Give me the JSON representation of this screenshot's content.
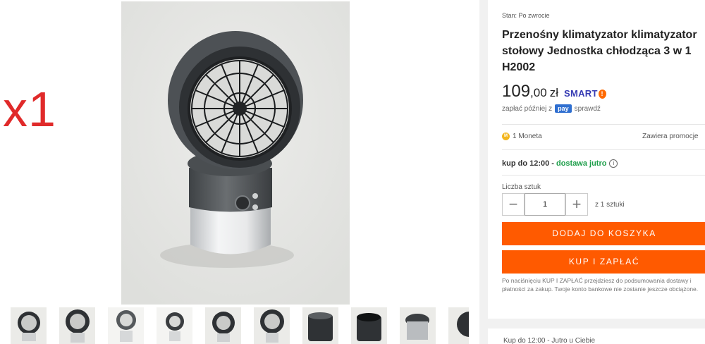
{
  "overlay": {
    "label": "x1",
    "color": "#e02a2a"
  },
  "gallery": {
    "thumbnail_count": 10
  },
  "product": {
    "condition": "Stan: Po zwrocie",
    "title_lines": [
      "Przenośny klimatyzator klimatyzator",
      "stołowy Jednostka chłodząca 3 w 1",
      "H2002"
    ],
    "price_int": "109",
    "price_dec": ",00",
    "currency": "zł",
    "smart_label": "SMART",
    "pay_later_text": "zapłać później z",
    "pay_brand": "pay",
    "pay_check": "sprawdź",
    "coin_label": "1 Moneta",
    "promo_label": "Zawiera promocje",
    "delivery_prefix": "kup do 12:00 -",
    "delivery_highlight": "dostawa jutro",
    "qty_label": "Liczba sztuk",
    "qty_value": "1",
    "qty_of": "z 1 sztuki",
    "add_to_cart": "DODAJ DO KOSZYKA",
    "buy_now": "KUP I ZAPŁAĆ",
    "disclaimer": "Po naciśnięciu KUP I ZAPŁAĆ przejdziesz do podsumowania dostawy i płatności za zakup. Twoje konto bankowe nie zostanie jeszcze obciążone.",
    "bottom_hint": "Kup do 12:00 - Jutro u Ciebie"
  },
  "colors": {
    "accent": "#ff5a00",
    "smart": "#363bb3",
    "delivery_green": "#1e9e4a"
  },
  "icons": [
    "minus-icon",
    "plus-icon",
    "info-icon",
    "coin-icon",
    "smart-badge-icon"
  ]
}
